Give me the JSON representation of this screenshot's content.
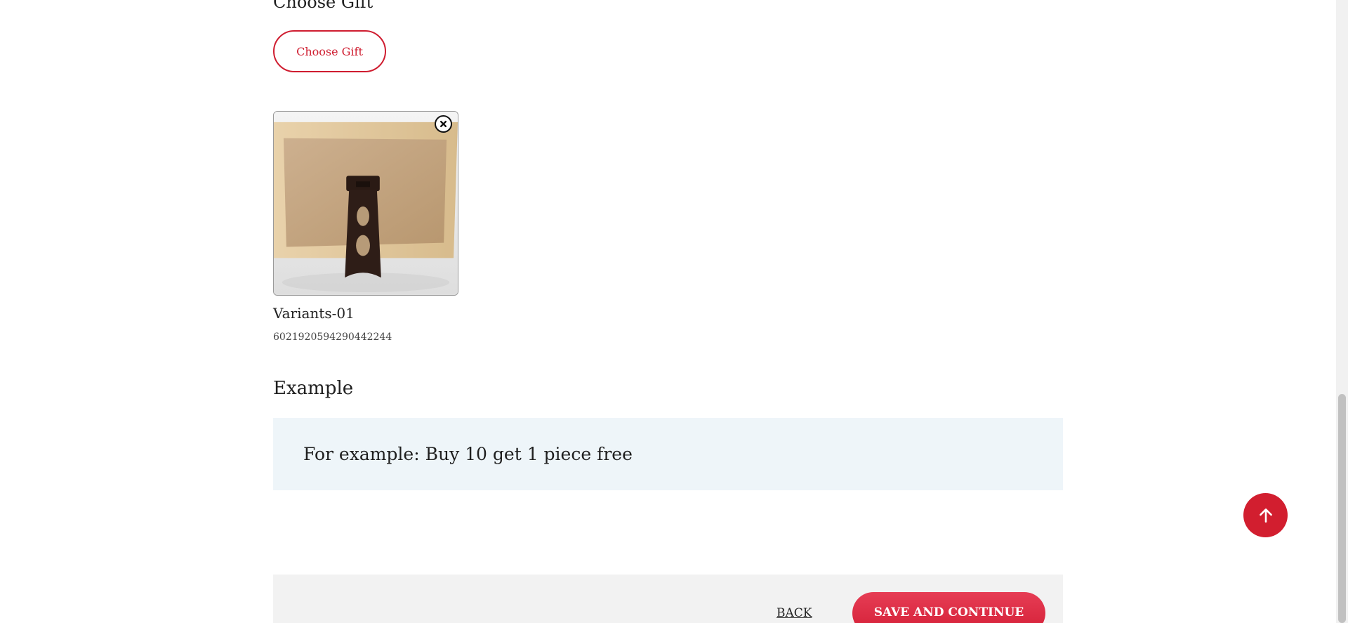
{
  "gift_section": {
    "title": "Choose Gift",
    "button_label": "Choose Gift",
    "selected_gift": {
      "name": "Variants-01",
      "id": "6021920594290442244",
      "image_icon": "picture-frame-back-photo",
      "remove_icon": "close-circle-icon"
    }
  },
  "example_section": {
    "title": "Example",
    "text": "For example: Buy 10 get 1 piece free"
  },
  "footer": {
    "back_label": "BACK",
    "save_label": "SAVE AND CONTINUE"
  },
  "scroll_top": {
    "icon": "arrow-up-icon"
  },
  "colors": {
    "accent": "#cf1d30",
    "example_bg": "#eef5f9",
    "footer_bg": "#f2f2f2"
  }
}
